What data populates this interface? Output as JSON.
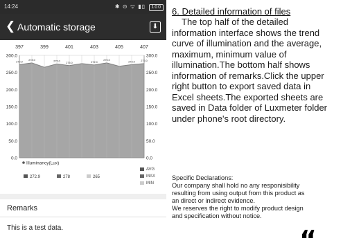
{
  "status": {
    "time": "14:24",
    "icons": "✱ ⊙ ᯤ ▮▯",
    "battery": "100"
  },
  "appbar": {
    "title": "Automatic storage",
    "back_icon": "chevron-left-icon",
    "export_icon": "download-icon"
  },
  "chart_data": {
    "type": "area",
    "top_axis_labels": [
      "397",
      "399",
      "401",
      "403",
      "405",
      "407"
    ],
    "y_ticks": [
      "300.0",
      "250.0",
      "200.0",
      "150.0",
      "100.0",
      "50.0",
      "0.0"
    ],
    "ylim": [
      0,
      300
    ],
    "series": [
      {
        "name": "Illuminancy(Lux)",
        "values": [
          272.9,
          278,
          265,
          275.0,
          270.0,
          276.0,
          272.0,
          278.0,
          268.0,
          273.0,
          276.0
        ]
      }
    ],
    "point_labels": [
      "272.9",
      "278.0",
      "",
      "275.0",
      "275.0",
      "",
      "272.0",
      "275.0",
      "",
      "273.0",
      "276.0"
    ],
    "legend": "Illuminancy(Lux)",
    "stats": [
      {
        "name": "AVG",
        "value": "272.9",
        "color": "#555555"
      },
      {
        "name": "MAX",
        "value": "278",
        "color": "#666666"
      },
      {
        "name": "MIN",
        "value": "265",
        "color": "#cccccc"
      }
    ],
    "fill_color": "#a6a6a6",
    "line_color": "#808080"
  },
  "remarks": {
    "title": "Remarks",
    "text": "This is a test data."
  },
  "doc": {
    "heading": "6. Detailed information of files",
    "lines": [
      "The top half of the detailed",
      "information interface shows the trend",
      "curve of illumination and the average,",
      "maximum, minimum value of",
      "illumination.The bottom half shows",
      "information of remarks.Click the upper",
      "right button to export saved data in",
      "Excel sheets.The exported sheets are",
      "saved in Data folder of Luxmeter folder",
      "under phone's root directory."
    ]
  },
  "declarations": {
    "lines": [
      "Specific Declarations:",
      "Our company shall hold no any responisibility",
      "resulting from using output from this product as",
      "an direct or indirect evidence.",
      "We reserves the right to modify product design",
      "and specification without notice."
    ]
  },
  "corner_mark": "“"
}
